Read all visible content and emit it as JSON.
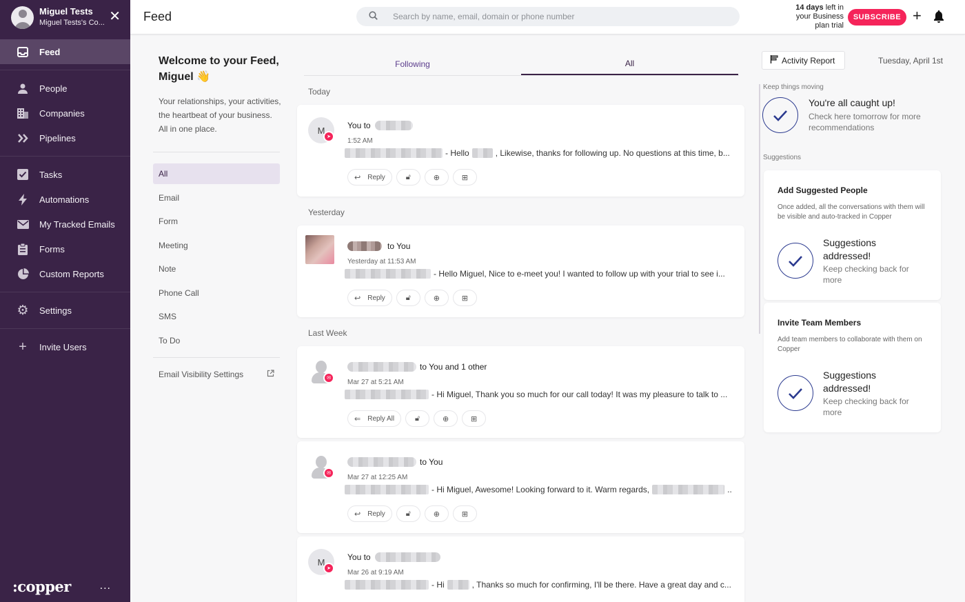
{
  "sidebar": {
    "user_name": "Miguel Tests",
    "org_name": "Miguel Tests's Co...",
    "items": [
      {
        "label": "Feed"
      },
      {
        "label": "People"
      },
      {
        "label": "Companies"
      },
      {
        "label": "Pipelines"
      },
      {
        "label": "Tasks"
      },
      {
        "label": "Automations"
      },
      {
        "label": "My Tracked Emails"
      },
      {
        "label": "Forms"
      },
      {
        "label": "Custom Reports"
      },
      {
        "label": "Settings"
      },
      {
        "label": "Invite Users"
      }
    ],
    "logo": ":copper",
    "more": "..."
  },
  "header": {
    "title": "Feed",
    "search_placeholder": "Search by name, email, domain or phone number",
    "trial_days": "14 days",
    "trial_rest1": " left in",
    "trial_line2": "your Business",
    "trial_line3": "plan trial",
    "subscribe_label": "SUBSCRIBE"
  },
  "filters": {
    "welcome_title": "Welcome to your Feed, Miguel 👋",
    "welcome_text": "Your relationships, your activities, the heartbeat of your business. All in one place.",
    "items": [
      {
        "label": "All"
      },
      {
        "label": "Email"
      },
      {
        "label": "Form"
      },
      {
        "label": "Meeting"
      },
      {
        "label": "Note"
      },
      {
        "label": "Phone Call"
      },
      {
        "label": "SMS"
      },
      {
        "label": "To Do"
      }
    ],
    "visibility_label": "Email Visibility Settings"
  },
  "feed": {
    "tabs": [
      {
        "label": "Following"
      },
      {
        "label": "All"
      }
    ],
    "sections": {
      "today": "Today",
      "yesterday": "Yesterday",
      "last_week": "Last Week"
    },
    "cards": [
      {
        "avatar": "M",
        "prefix": "You to",
        "suffix": "",
        "time": "1:52 AM",
        "body": "- Hello",
        "body2": ", Likewise, thanks for following up. No questions at this time, b...",
        "reply": "Reply"
      },
      {
        "avatar": "",
        "prefix": "",
        "suffix": "to You",
        "time": "Yesterday at 11:53 AM",
        "body": "- Hello Miguel, Nice to e-meet you! I wanted to follow up with your trial to see i...",
        "body2": "",
        "reply": "Reply"
      },
      {
        "avatar": "",
        "prefix": "",
        "suffix": "to You and 1 other",
        "time": "Mar 27 at 5:21 AM",
        "body": "- Hi Miguel, Thank you so much for our call today! It was my pleasure to talk to ...",
        "body2": "",
        "reply": "Reply All"
      },
      {
        "avatar": "",
        "prefix": "",
        "suffix": "to You",
        "time": "Mar 27 at 12:25 AM",
        "body": "- Hi Miguel, Awesome! Looking forward to it. Warm regards,",
        "body2": "...",
        "reply": "Reply"
      },
      {
        "avatar": "M",
        "prefix": "You to",
        "suffix": "",
        "time": "Mar 26 at 9:19 AM",
        "body": "- Hi",
        "body2": ", Thanks so much for confirming, I'll be there. Have a great day and c...",
        "reply": "Reply"
      }
    ]
  },
  "right": {
    "activity_report": "Activity Report",
    "date": "Tuesday, April 1st",
    "keep_moving": "Keep things moving",
    "caught_up_title": "You're all caught up!",
    "caught_up_sub": "Check here tomorrow for more recommendations",
    "suggestions_label": "Suggestions",
    "suggest_people_title": "Add Suggested People",
    "suggest_people_desc": "Once added, all the conversations with them will be visible and auto-tracked in Copper",
    "invite_title": "Invite Team Members",
    "invite_desc": "Add team members to collaborate with them on Copper",
    "addressed_title": "Suggestions addressed!",
    "addressed_sub": "Keep checking back for more"
  },
  "colors": {
    "sidebar_bg": "#3a2347",
    "accent_pink": "#f5245a",
    "check_blue": "#2b3a8f"
  }
}
